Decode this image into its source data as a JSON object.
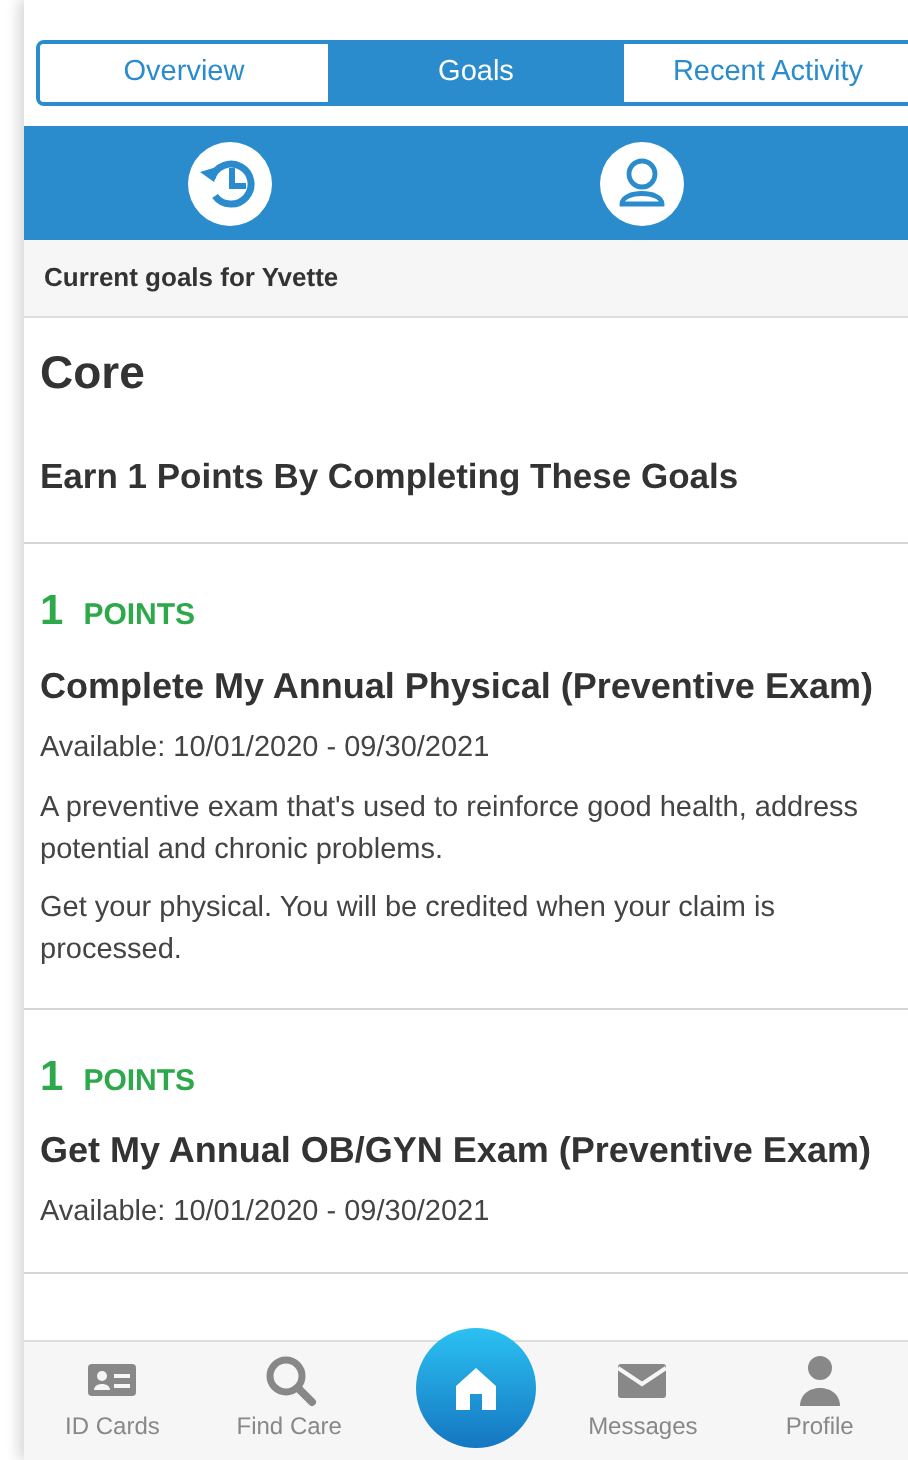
{
  "tabs": [
    {
      "label": "Overview",
      "selected": false
    },
    {
      "label": "Goals",
      "selected": true
    },
    {
      "label": "Recent Activity",
      "selected": false
    }
  ],
  "toolbar": [
    {
      "kind": "history"
    },
    {
      "kind": "person"
    }
  ],
  "subtitle": "Current goals for Yvette",
  "section": {
    "title": "Core",
    "subtitle": "Earn 1 Points By Completing These Goals"
  },
  "goals": [
    {
      "points": "1",
      "points_label": "POINTS",
      "title": "Complete My Annual Physical (Preventive Exam)",
      "available": "Available: 10/01/2020 - 09/30/2021",
      "paragraphs": [
        "A preventive exam that's used to reinforce good health, address potential and chronic problems.",
        "Get your physical. You will be credited when your claim is processed."
      ]
    },
    {
      "points": "1",
      "points_label": "POINTS",
      "title": "Get My Annual OB/GYN Exam (Preventive Exam)",
      "available": "Available: 10/01/2020 - 09/30/2021"
    }
  ],
  "bottom_nav": [
    {
      "kind": "id-card",
      "label": "ID Cards"
    },
    {
      "kind": "search",
      "label": "Find Care"
    },
    {
      "kind": "home"
    },
    {
      "kind": "mail",
      "label": "Messages"
    },
    {
      "kind": "person",
      "label": "Profile"
    }
  ]
}
